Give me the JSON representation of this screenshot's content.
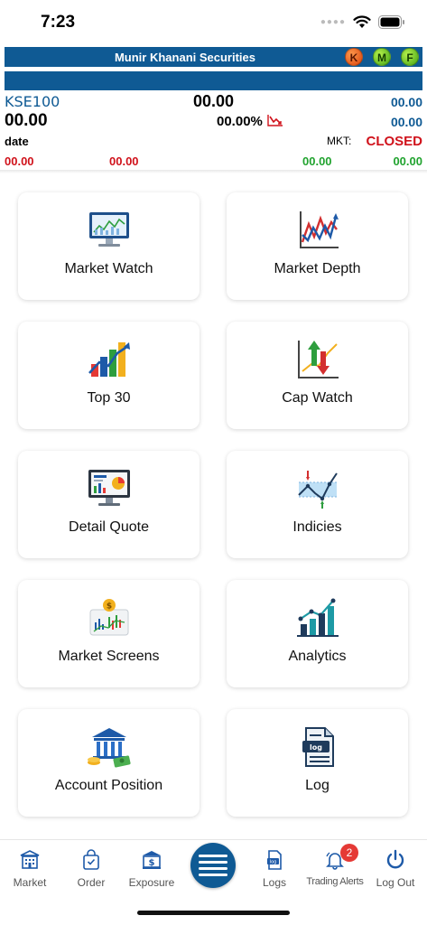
{
  "status_bar": {
    "time": "7:23"
  },
  "header": {
    "title": "Munir Khanani Securities",
    "buttons": [
      "K",
      "M",
      "F"
    ]
  },
  "index": {
    "name": "KSE100",
    "current_value": "00.00",
    "right_value_1": "00.00",
    "change": "00.00",
    "change_percent": "00.00%",
    "right_value_2": "00.00",
    "date": "date",
    "market_label": "MKT:",
    "market_status": "CLOSED",
    "low_1": "00.00",
    "low_2": "00.00",
    "high_1": "00.00",
    "high_2": "00.00"
  },
  "tiles": [
    {
      "label": "Market Watch",
      "icon": "monitor-chart-icon"
    },
    {
      "label": "Market Depth",
      "icon": "line-chart-arrows-icon"
    },
    {
      "label": "Top 30",
      "icon": "bar-chart-trend-icon"
    },
    {
      "label": "Cap Watch",
      "icon": "up-down-arrows-icon"
    },
    {
      "label": "Detail Quote",
      "icon": "dashboard-monitor-icon"
    },
    {
      "label": "Indicies",
      "icon": "range-chart-icon"
    },
    {
      "label": "Market Screens",
      "icon": "dollar-screen-icon"
    },
    {
      "label": "Analytics",
      "icon": "analytics-chart-icon"
    },
    {
      "label": "Account Position",
      "icon": "bank-money-icon"
    },
    {
      "label": "Log",
      "icon": "log-document-icon"
    }
  ],
  "bottom_nav": {
    "market": "Market",
    "order": "Order",
    "exposure": "Exposure",
    "logs": "Logs",
    "trading_alerts": "Trading Alerts",
    "alerts_count": "2",
    "logout": "Log Out"
  },
  "colors": {
    "brand_blue": "#0f5a94",
    "status_red": "#d0121b",
    "status_green": "#21a32f"
  }
}
